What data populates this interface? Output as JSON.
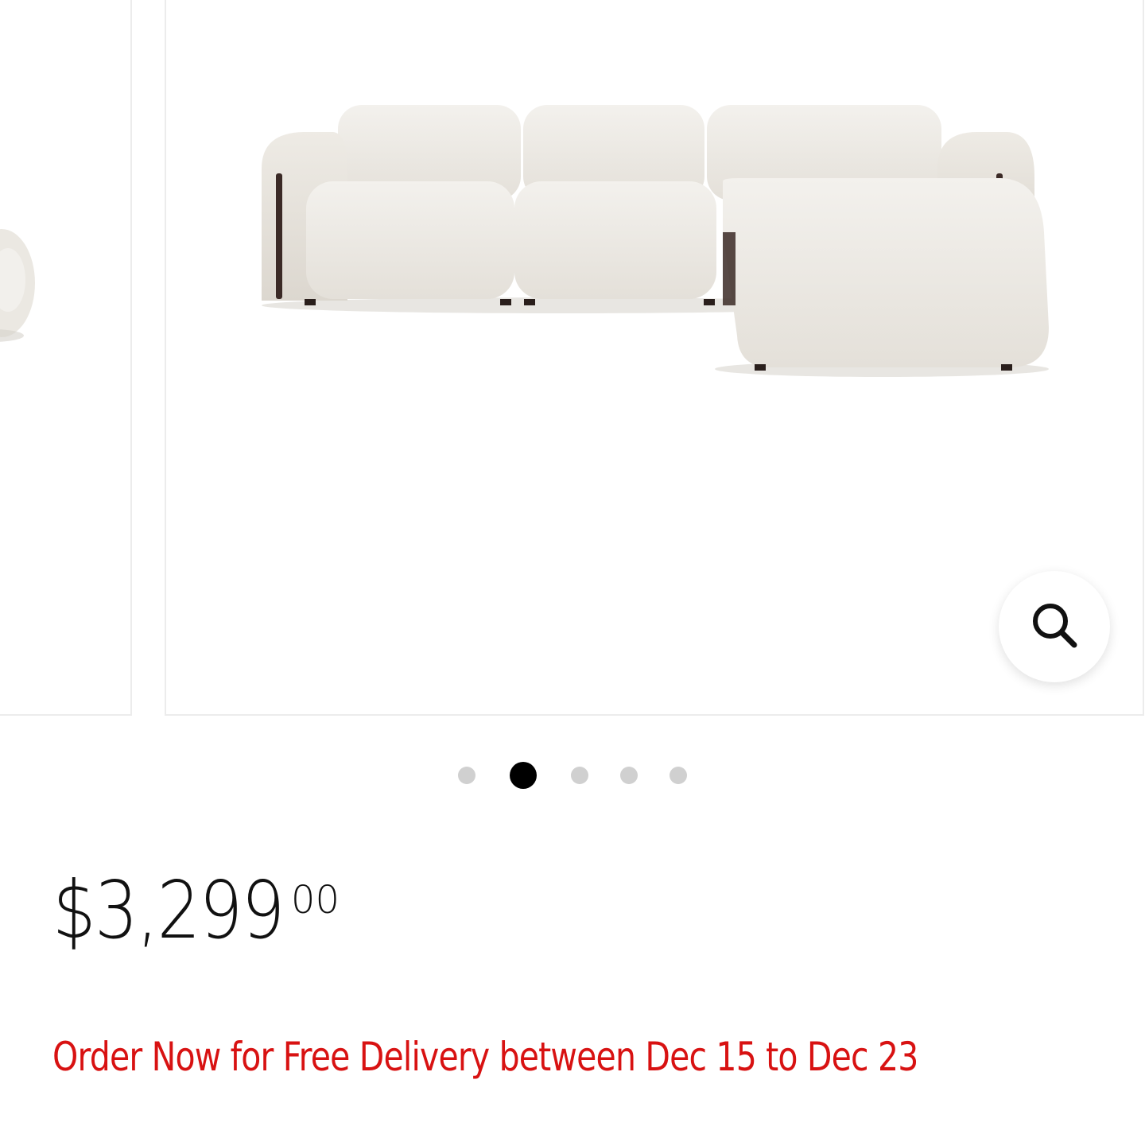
{
  "gallery": {
    "active_slide": 2,
    "slide_count": 5,
    "zoom_icon": "magnifier-icon",
    "colors": {
      "dot_active": "#000000",
      "dot_inactive": "#d0d0d0",
      "sofa_fabric": "#ebe8e2",
      "sofa_frame": "#3b2a26"
    }
  },
  "product": {
    "price_main": "$3,299",
    "price_cents": "00"
  },
  "delivery": {
    "message": "Order Now for Free Delivery between Dec 15 to Dec 23",
    "color": "#d81212"
  }
}
